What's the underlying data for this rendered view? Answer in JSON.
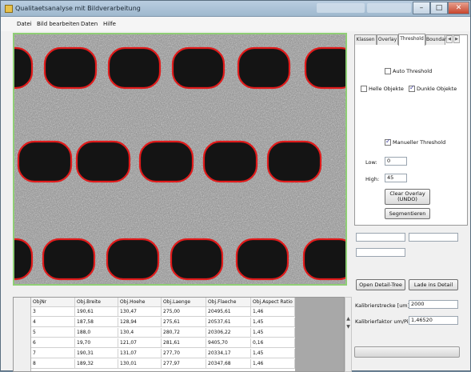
{
  "window": {
    "title": "Qualitaetsanalyse mit Bildverarbeitung",
    "controls": {
      "minimize": "–",
      "maximize": "□",
      "close": "✕"
    }
  },
  "menu": [
    "Datei",
    "Bild bearbeiten",
    "Daten",
    "Hilfe"
  ],
  "tabs": [
    {
      "label": "Klassen",
      "active": false
    },
    {
      "label": "Overlay",
      "active": false
    },
    {
      "label": "Threshold",
      "active": true
    },
    {
      "label": "Boundar",
      "active": false
    }
  ],
  "threshold_panel": {
    "auto_threshold": {
      "label": "Auto Threshold",
      "checked": false
    },
    "helle_objekte": {
      "label": "Helle Objekte",
      "checked": false
    },
    "dunkle_objekte": {
      "label": "Dunkle Objekte",
      "checked": true
    },
    "manueller_threshold": {
      "label": "Manueller Threshold",
      "checked": true
    },
    "low_label": "Low:",
    "low_value": "0",
    "high_label": "High:",
    "high_value": "45",
    "clear_overlay_label": "Clear Overlay (UNDO)",
    "segmentieren_label": "Segmentieren"
  },
  "buttons": {
    "open_detail": "Open Detail-Tree",
    "load_detail": "Lade ins Detail"
  },
  "kalibrierung": {
    "strecke_label": "Kalibrierstrecke [um]:",
    "strecke_value": "2000",
    "faktor_label": "Kalibrierfaktor um/Pixel:",
    "faktor_value": "1,46520"
  },
  "table": {
    "columns": [
      "ObjNr",
      "Obj.Breite",
      "Obj.Hoehe",
      "Obj.Laenge",
      "Obj.Flaeche",
      "Obj.Aspect Ratio"
    ],
    "rows": [
      [
        "3",
        "190,61",
        "130,47",
        "275,00",
        "20495,61",
        "1,46"
      ],
      [
        "4",
        "187,58",
        "128,94",
        "275,61",
        "20537,61",
        "1,45"
      ],
      [
        "5",
        "188,0",
        "130,4",
        "280,72",
        "20306,22",
        "1,45"
      ],
      [
        "6",
        "19,70",
        "121,07",
        "281,61",
        "9405,70",
        "0,16"
      ],
      [
        "7",
        "190,31",
        "131,07",
        "277,70",
        "20334,17",
        "1,45"
      ],
      [
        "8",
        "189,32",
        "130,01",
        "277,97",
        "20347,68",
        "1,46"
      ]
    ]
  },
  "colors": {
    "hole_outline": "#e01b1b",
    "hole_fill": "#141414",
    "image_border": "#8fce75",
    "titlebar": "#a9c1d6"
  }
}
